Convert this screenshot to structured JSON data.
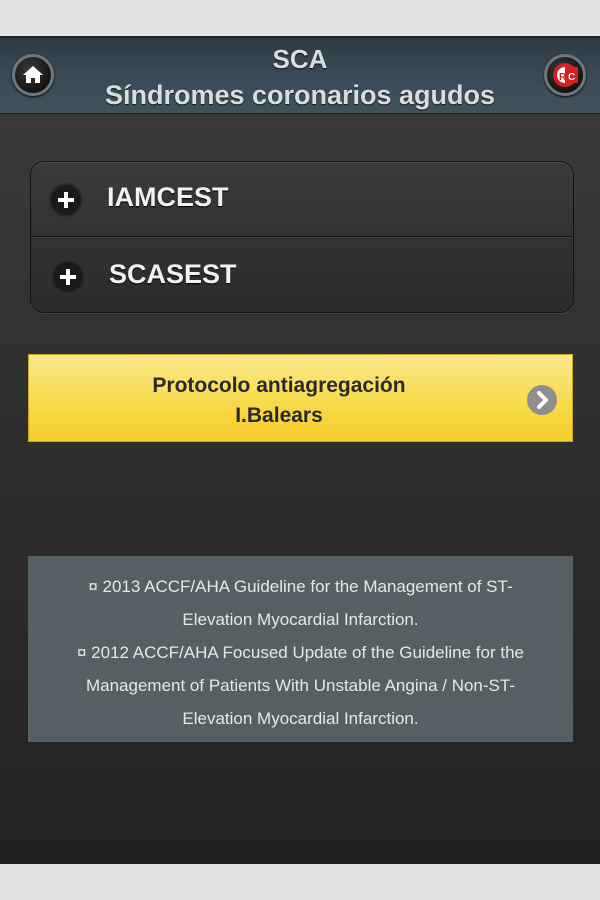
{
  "header": {
    "title_line1": "SCA",
    "title_line2": "Síndromes coronarios agudos",
    "home_icon": "home-icon",
    "brand_icon": "rc-logo-icon"
  },
  "accordion": {
    "items": [
      {
        "label": "IAMCEST",
        "icon": "plus-icon"
      },
      {
        "label": "SCASEST",
        "icon": "plus-icon"
      }
    ]
  },
  "protocol_button": {
    "line1": "Protocolo antiagregación",
    "line2": "I.Balears",
    "icon": "chevron-right-icon",
    "color": "#f8d946"
  },
  "references": {
    "lines": [
      "¤ 2013 ACCF/AHA Guideline for the Management of ST-",
      "Elevation Myocardial Infarction.",
      "¤ 2012 ACCF/AHA Focused Update of the Guideline for the",
      "Management of Patients With Unstable Angina / Non-ST-",
      "Elevation Myocardial Infarction."
    ]
  },
  "colors": {
    "header_bg": "#3a4b57",
    "accent_yellow": "#f8d946",
    "refs_bg": "#566064"
  }
}
